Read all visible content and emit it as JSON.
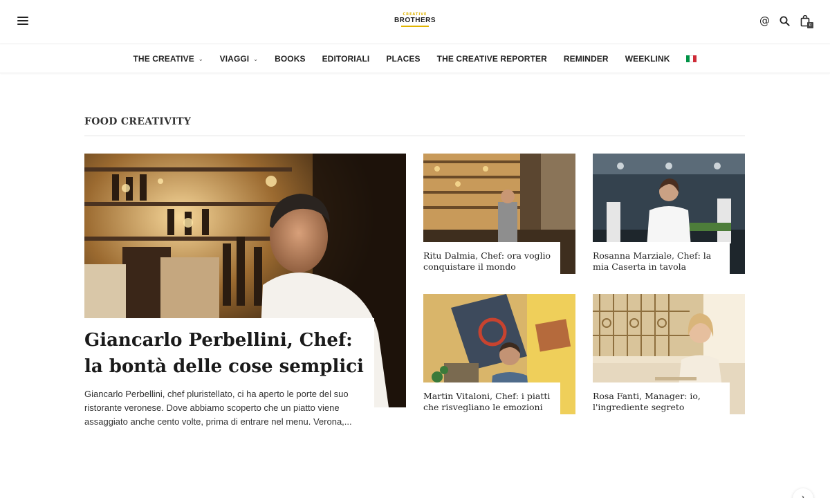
{
  "header": {
    "menu_icon": "hamburger-menu-icon",
    "logo": {
      "top_text": "CREATIVE",
      "main_text": "BROTHERS"
    },
    "icons": [
      "at-icon",
      "search-icon",
      "shopping-bag-icon"
    ],
    "cart_count": "0"
  },
  "nav": {
    "items": [
      {
        "label": "THE CREATIVE",
        "has_dropdown": true
      },
      {
        "label": "VIAGGI",
        "has_dropdown": true
      },
      {
        "label": "BOOKS",
        "has_dropdown": false
      },
      {
        "label": "EDITORIALI",
        "has_dropdown": false
      },
      {
        "label": "PLACES",
        "has_dropdown": false
      },
      {
        "label": "THE CREATIVE REPORTER",
        "has_dropdown": false
      },
      {
        "label": "REMINDER",
        "has_dropdown": false
      },
      {
        "label": "WEEKLINK",
        "has_dropdown": false
      }
    ],
    "flag_icon": "italian-flag-icon",
    "flag_colors": [
      "#009246",
      "#ffffff",
      "#ce2b37"
    ]
  },
  "section": {
    "title": "FOOD CREATIVITY"
  },
  "featured": {
    "title": "Giancarlo Perbellini, Chef: la bontà delle cose semplici",
    "excerpt": "Giancarlo Perbellini, chef pluristellato, ci ha aperto le porte del suo ristorante veronese. Dove abbiamo scoperto che un piatto viene assaggiato anche cento volte, prima di entrare nel menu.     Verona,..."
  },
  "articles": [
    {
      "title": "Ritu Dalmia, Chef: ora voglio conquistare il mondo"
    },
    {
      "title": "Rosanna Marziale, Chef: la mia Caserta in tavola"
    },
    {
      "title": "Martin Vitaloni, Chef: i piatti che risvegliano le emozioni"
    },
    {
      "title": "Rosa Fanti, Manager: io, l'ingrediente segreto"
    }
  ],
  "colors": {
    "logo_accent": "#e0b400",
    "text": "#222222",
    "rule": "#e2e2e2"
  }
}
